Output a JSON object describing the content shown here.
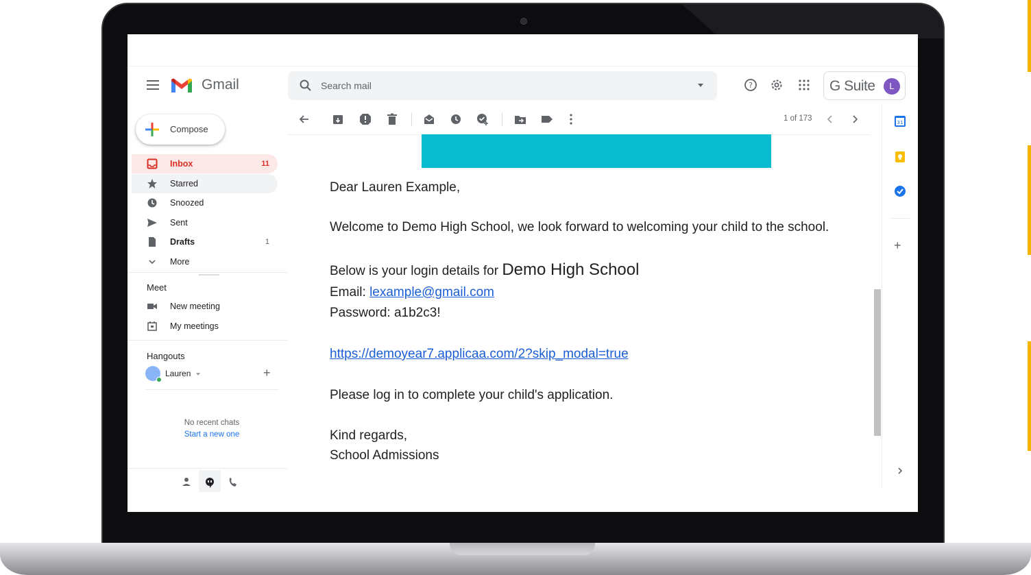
{
  "app": {
    "name": "Gmail",
    "brand_suite": "G Suite",
    "avatar_letter": "L"
  },
  "search": {
    "placeholder": "Search mail"
  },
  "compose": {
    "label": "Compose"
  },
  "nav": {
    "items": [
      {
        "label": "Inbox",
        "count": "11",
        "icon": "inbox-icon"
      },
      {
        "label": "Starred",
        "count": "",
        "icon": "star-icon"
      },
      {
        "label": "Snoozed",
        "count": "",
        "icon": "clock-icon"
      },
      {
        "label": "Sent",
        "count": "",
        "icon": "send-icon"
      },
      {
        "label": "Drafts",
        "count": "1",
        "icon": "draft-icon"
      },
      {
        "label": "More",
        "count": "",
        "icon": "chevron-down-icon"
      }
    ]
  },
  "meet": {
    "title": "Meet",
    "new_meeting": "New meeting",
    "my_meetings": "My meetings"
  },
  "hangouts": {
    "title": "Hangouts",
    "user": "Lauren",
    "no_recent": "No recent chats",
    "start_new": "Start a new one"
  },
  "toolbar": {
    "pager": "1 of 173"
  },
  "message": {
    "greeting": "Dear Lauren Example,",
    "welcome": "Welcome to Demo High School, we look forward to welcoming your child to the school.",
    "login_intro": "Below is your login details for ",
    "school_name": "Demo High School",
    "email_label": "Email: ",
    "email": "lexample@gmail.com",
    "password_line": "Password: a1b2c3!",
    "link": "https://demoyear7.applicaa.com/2?skip_modal=true",
    "instruction": "Please log in to complete your child's application.",
    "closing": "Kind regards,",
    "signature": "School Admissions"
  },
  "colors": {
    "banner": "#09bcd0",
    "inbox_active": "#d93025",
    "accent_yellow": "#f4b400",
    "link": "#1a5ed6"
  }
}
